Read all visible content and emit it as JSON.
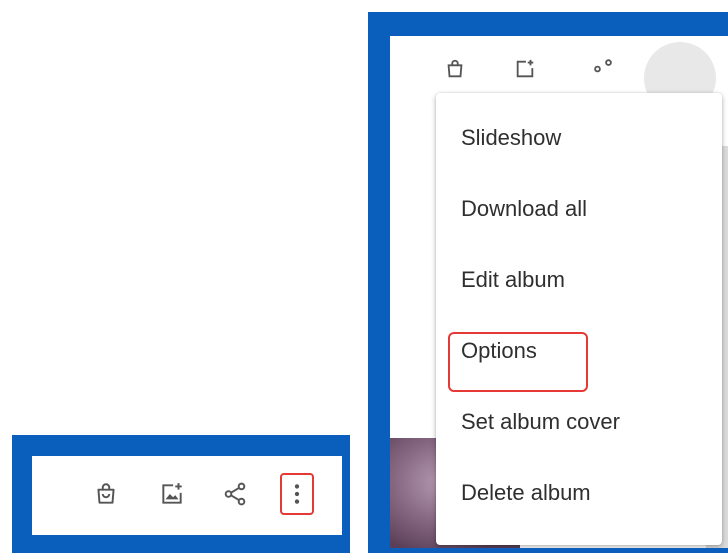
{
  "colors": {
    "frame": "#0a5fbd",
    "highlight": "#e53935",
    "icon": "#555555",
    "menu_text": "#2f2f2f"
  },
  "toolbar": {
    "icons": [
      "shopping-bag-icon",
      "add-photo-icon",
      "share-icon",
      "more-vertical-icon"
    ]
  },
  "menu": {
    "items": [
      {
        "label": "Slideshow"
      },
      {
        "label": "Download all"
      },
      {
        "label": "Edit album"
      },
      {
        "label": "Options"
      },
      {
        "label": "Set album cover"
      },
      {
        "label": "Delete album"
      }
    ],
    "highlighted_item": "Options"
  }
}
